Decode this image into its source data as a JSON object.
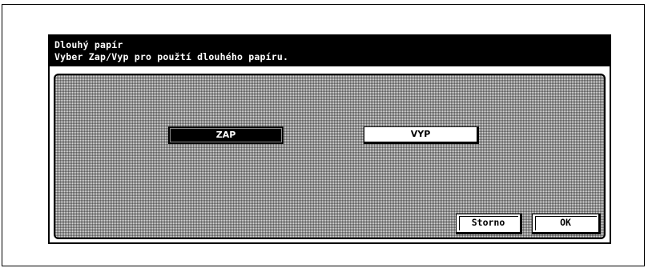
{
  "dialog": {
    "title": "Dlouhý papír",
    "subtitle": "Vyber Zap/Vyp pro použtí dlouhého papíru."
  },
  "options": {
    "on_label": "ZAP",
    "off_label": "VYP",
    "selected": "ZAP"
  },
  "footer": {
    "cancel_label": "Storno",
    "ok_label": "OK"
  },
  "colors": {
    "header_bg": "#000000",
    "header_text": "#ffffff",
    "selected_bg": "#000000",
    "panel_pattern": "#d8d8d8"
  }
}
